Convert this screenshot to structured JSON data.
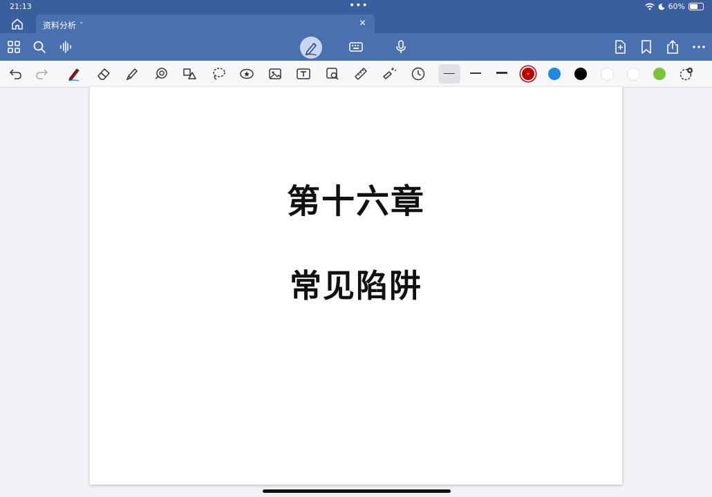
{
  "status": {
    "time": "21:13",
    "battery": "60%",
    "battery_level": 0.6
  },
  "tab": {
    "title": "资料分析",
    "close": "×"
  },
  "nav": {
    "left_icons": [
      "grid-icon",
      "search-icon",
      "audio-wave-icon"
    ],
    "center_icons": [
      "pen-mode-icon",
      "keyboard-icon",
      "microphone-icon"
    ],
    "right_icons": [
      "add-page-icon",
      "bookmark-icon",
      "share-icon",
      "more-icon"
    ]
  },
  "tools": {
    "items": [
      "undo-icon",
      "redo-icon",
      "pen-icon",
      "eraser-icon",
      "highlighter-icon",
      "shapes-icon",
      "shape-tool-icon",
      "lasso-icon",
      "sticker-icon",
      "image-icon",
      "text-icon",
      "image-search-icon",
      "ruler-icon",
      "laser-pointer-icon",
      "clock-icon"
    ],
    "colors": [
      "#c00000",
      "#1e88e5",
      "#000000",
      "#ffffff",
      "#ffffff",
      "#7cc43a"
    ],
    "selected_color": "#c00000"
  },
  "page": {
    "chapter": "第十六章",
    "subtitle": "常见陷阱"
  }
}
